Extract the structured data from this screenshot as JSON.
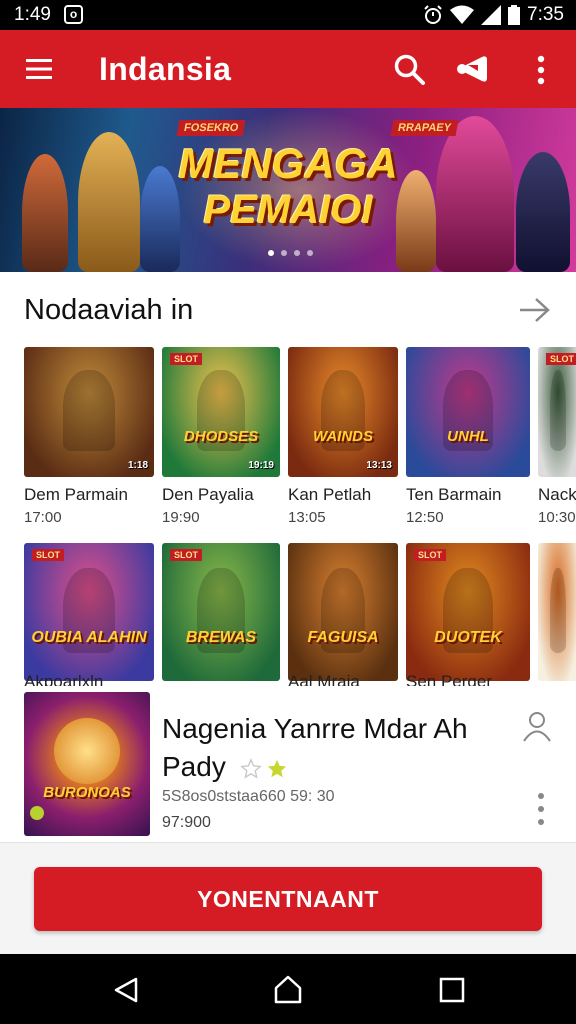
{
  "status_bar": {
    "time_left": "1:49",
    "notification_glyph": "o",
    "time_right": "7:35",
    "icons": [
      "alarm-icon",
      "wifi-icon",
      "signal-icon",
      "battery-icon"
    ]
  },
  "app_bar": {
    "title": "Indansia",
    "icons": [
      "menu-icon",
      "search-icon",
      "share-icon",
      "more-vert-icon"
    ]
  },
  "banner": {
    "tag_left": "FOSEKRO",
    "tag_right": "RRAPAEY",
    "title_line1": "MENGAGA",
    "title_line2": "PEMAIOI",
    "dot_count": 4,
    "active_dot": 0
  },
  "section": {
    "title": "Nodaaviah in"
  },
  "row1": [
    {
      "name": "Dem Parmain",
      "time": "17:00",
      "badge": "",
      "logo": "",
      "corner": "1:18",
      "colors": [
        "#5a2c14",
        "#c08a3a"
      ]
    },
    {
      "name": "Den Payalia",
      "time": "19:90",
      "badge": "SLOT",
      "logo": "DHODSES",
      "corner": "19:19",
      "colors": [
        "#1f7a3a",
        "#f2c14e"
      ]
    },
    {
      "name": "Kan Petlah",
      "time": "13:05",
      "badge": "",
      "logo": "WAINDS",
      "corner": "13:13",
      "colors": [
        "#7a2a10",
        "#e88a2a"
      ]
    },
    {
      "name": "Ten Barmain",
      "time": "12:50",
      "badge": "",
      "logo": "UNHL",
      "corner": "",
      "colors": [
        "#2a4a9a",
        "#c23a8a"
      ]
    },
    {
      "name": "Nack",
      "time": "10:30",
      "badge": "SLOT",
      "logo": "",
      "corner": "",
      "colors": [
        "#dddddd",
        "#3a5a3a"
      ]
    }
  ],
  "row2": [
    {
      "name": "Akpoarlxln",
      "badge": "SLOT",
      "logo": "OUBIA ALAHIN",
      "corner": "",
      "colors": [
        "#3a3aa0",
        "#e0508a"
      ]
    },
    {
      "name": "",
      "badge": "SLOT",
      "logo": "BREWAS",
      "corner": "",
      "colors": [
        "#1f6a3a",
        "#8ab84a"
      ]
    },
    {
      "name": "Aal Mraia",
      "badge": "",
      "logo": "FAGUISA",
      "corner": "",
      "colors": [
        "#5a3010",
        "#d88030"
      ]
    },
    {
      "name": "Sen Perger",
      "badge": "SLOT",
      "logo": "DUOTEK",
      "corner": "",
      "colors": [
        "#8a2a10",
        "#e08a20"
      ]
    },
    {
      "name": "",
      "badge": "",
      "logo": "",
      "corner": "",
      "colors": [
        "#f5f0e0",
        "#d86a20"
      ]
    }
  ],
  "featured": {
    "title_line1": "Nagenia Yanrre Mdar Ah",
    "title_line2": "Pady",
    "stars": [
      "empty",
      "filled"
    ],
    "meta": "5S8os0ststaa660 59: 30",
    "number": "97:900",
    "thumb_logo": "BURONOAS",
    "icons": [
      "user-icon",
      "more-vert-icon"
    ]
  },
  "action": {
    "button_label": "YONENTNAANT"
  },
  "colors": {
    "brand": "#d51b23",
    "star": "#c8d630"
  }
}
